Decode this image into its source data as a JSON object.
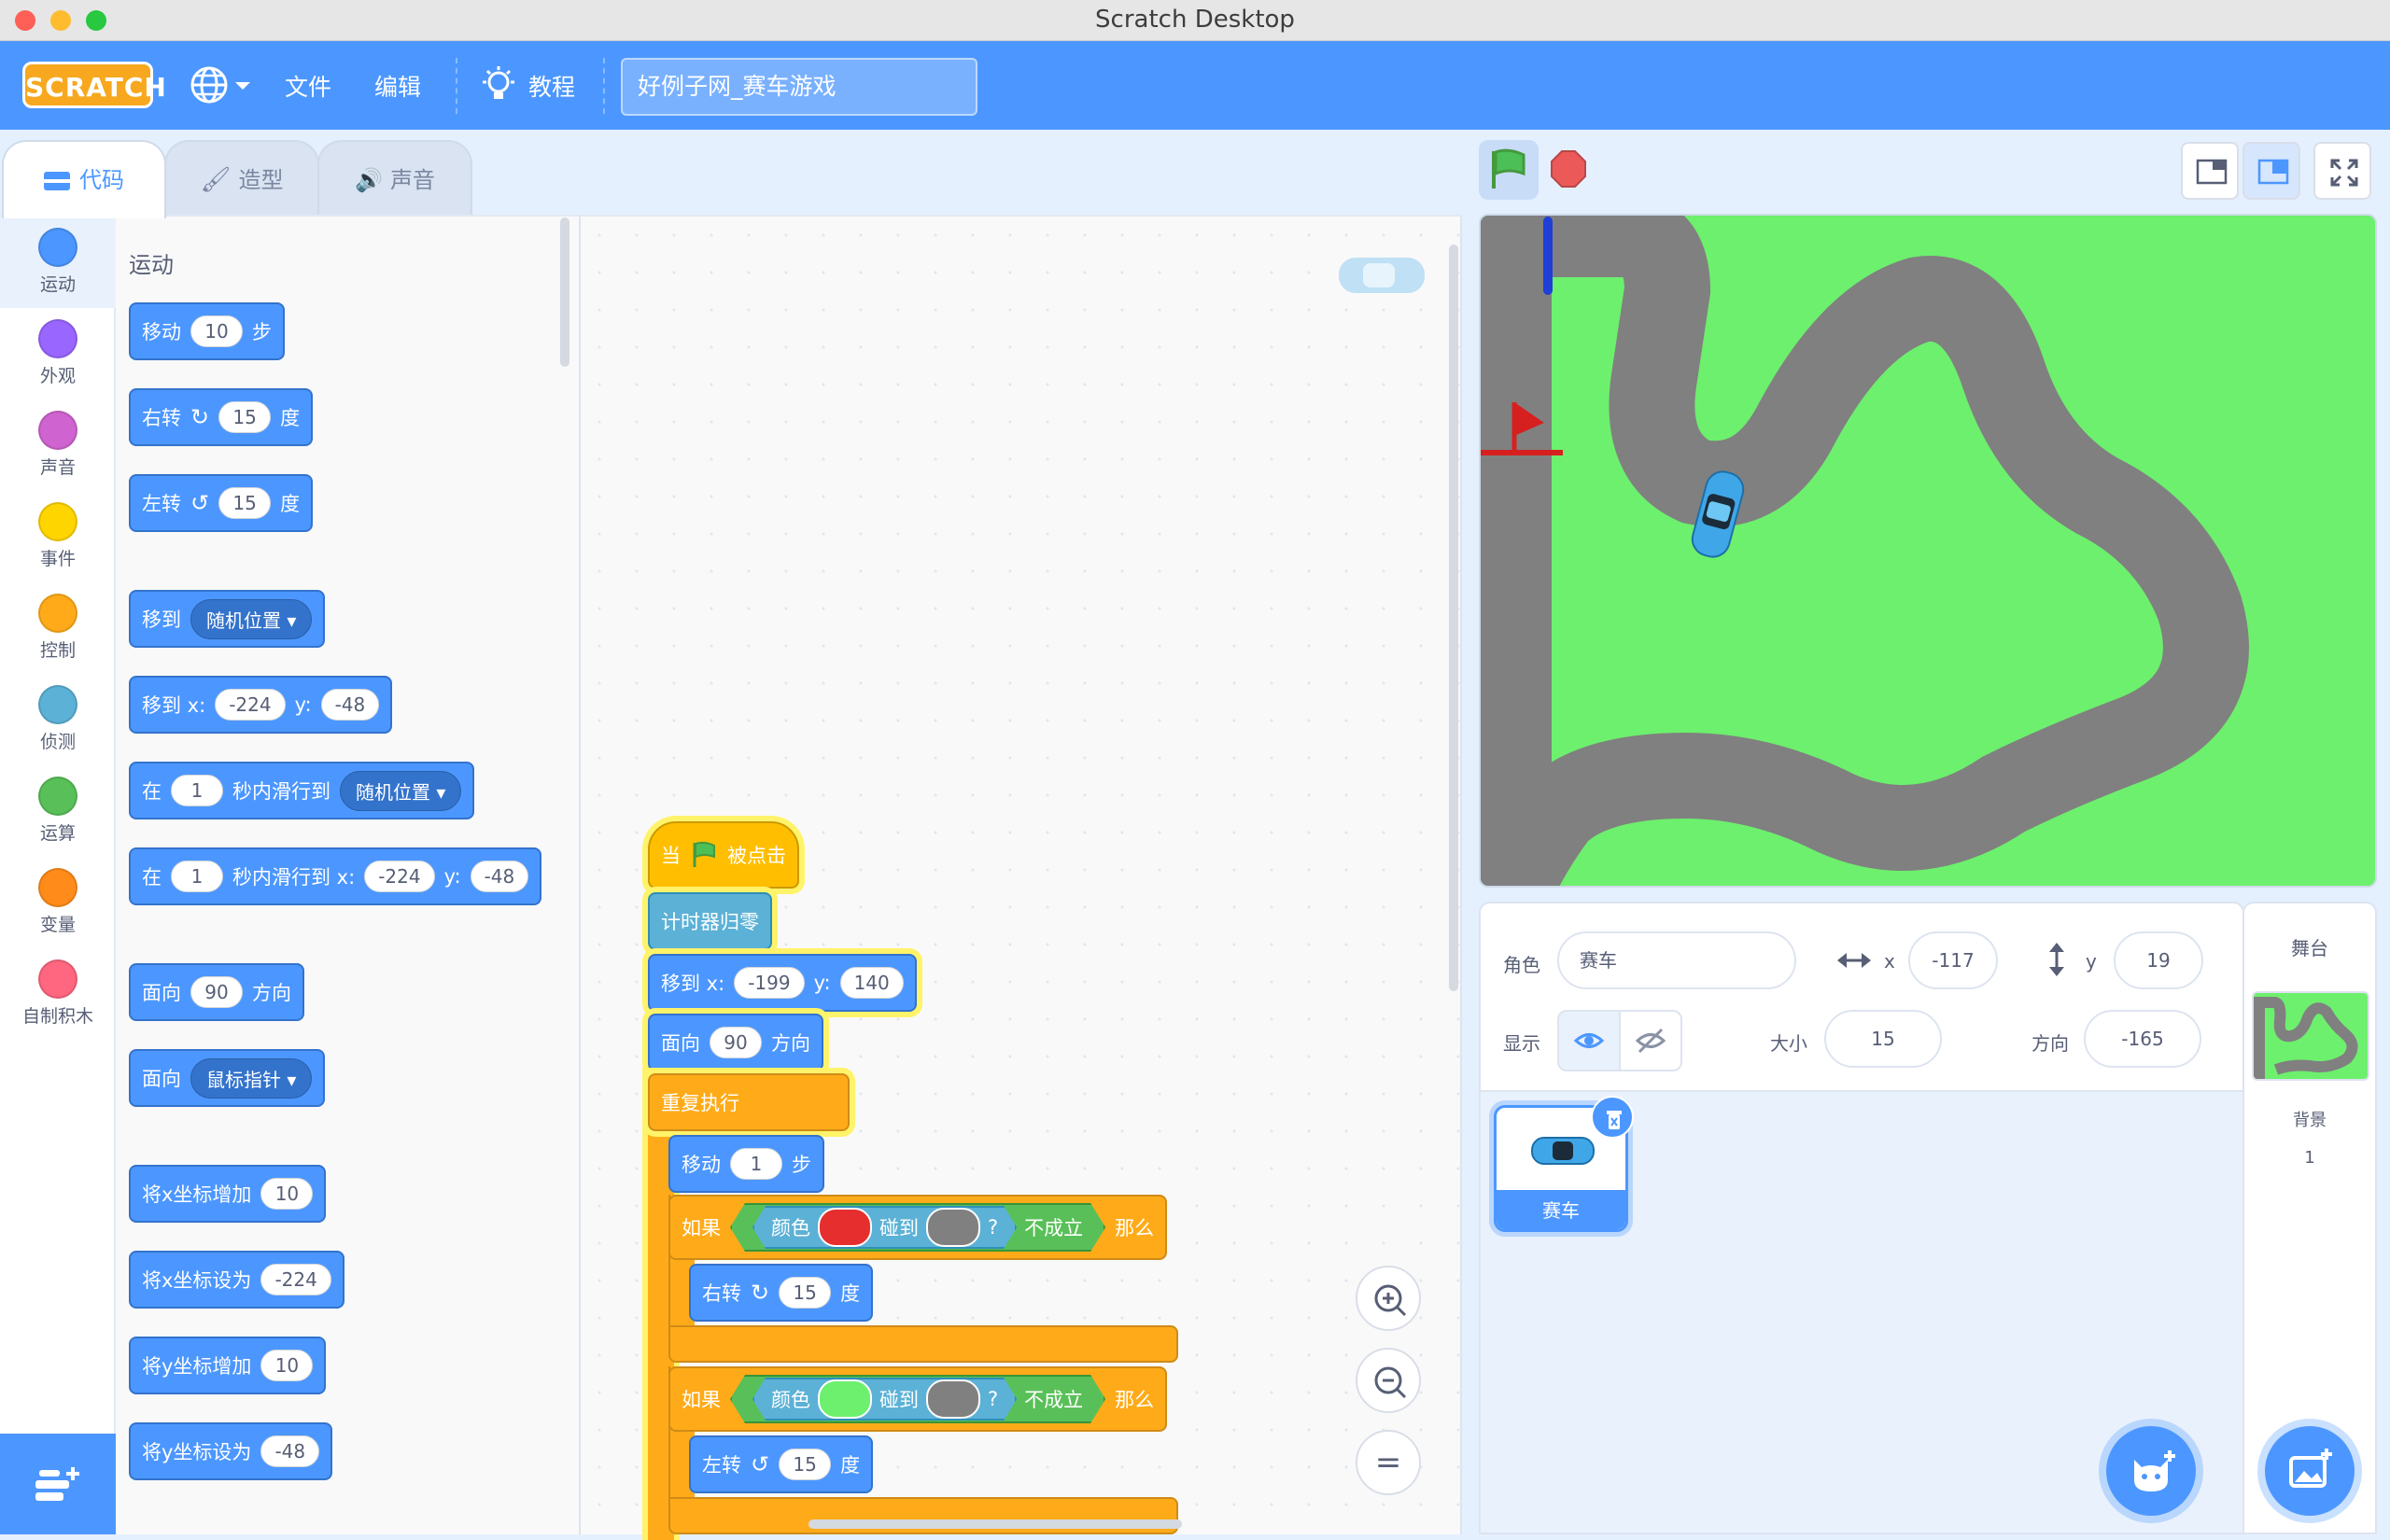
{
  "window": {
    "title": "Scratch Desktop"
  },
  "menubar": {
    "logo": "SCRATCH",
    "file": "文件",
    "edit": "编辑",
    "tutorials": "教程",
    "project_title": "好例子网_赛车游戏"
  },
  "tabs": {
    "code": "代码",
    "costumes": "造型",
    "sounds": "声音"
  },
  "categories": [
    {
      "label": "运动",
      "color": "#4c97ff"
    },
    {
      "label": "外观",
      "color": "#9966ff"
    },
    {
      "label": "声音",
      "color": "#cf63cf"
    },
    {
      "label": "事件",
      "color": "#ffd500"
    },
    {
      "label": "控制",
      "color": "#ffab19"
    },
    {
      "label": "侦测",
      "color": "#5cb1d6"
    },
    {
      "label": "运算",
      "color": "#59c059"
    },
    {
      "label": "变量",
      "color": "#ff8c1a"
    },
    {
      "label": "自制积木",
      "color": "#ff6680"
    }
  ],
  "palette": {
    "section_title": "运动",
    "move": {
      "label": "移动",
      "steps": "10",
      "unit": "步"
    },
    "turn_right": {
      "label": "右转",
      "deg": "15",
      "unit": "度"
    },
    "turn_left": {
      "label": "左转",
      "deg": "15",
      "unit": "度"
    },
    "goto": {
      "label": "移到",
      "target": "随机位置"
    },
    "goto_xy": {
      "label": "移到 x:",
      "x": "-224",
      "ylabel": "y:",
      "y": "-48"
    },
    "glide": {
      "pre": "在",
      "secs": "1",
      "mid": "秒内滑行到",
      "target": "随机位置"
    },
    "glide_xy": {
      "pre": "在",
      "secs": "1",
      "mid": "秒内滑行到 x:",
      "x": "-224",
      "ylabel": "y:",
      "y": "-48"
    },
    "point_dir": {
      "label": "面向",
      "dir": "90",
      "unit": "方向"
    },
    "point_towards": {
      "label": "面向",
      "target": "鼠标指针"
    },
    "change_x": {
      "label": "将x坐标增加",
      "val": "10"
    },
    "set_x": {
      "label": "将x坐标设为",
      "val": "-224"
    },
    "change_y": {
      "label": "将y坐标增加",
      "val": "10"
    },
    "set_y": {
      "label": "将y坐标设为",
      "val": "-48"
    }
  },
  "script": {
    "hat": {
      "pre": "当",
      "post": "被点击"
    },
    "reset_timer": "计时器归零",
    "goto_xy": {
      "label": "移到 x:",
      "x": "-199",
      "ylabel": "y:",
      "y": "140"
    },
    "point_dir": {
      "label": "面向",
      "dir": "90",
      "unit": "方向"
    },
    "forever": "重复执行",
    "move": {
      "label": "移动",
      "steps": "1",
      "unit": "步"
    },
    "if1": {
      "if": "如果",
      "color": "颜色",
      "touching": "碰到",
      "q": "?",
      "not": "不成立",
      "then": "那么",
      "c1": "#e62e2e",
      "c2": "#808080"
    },
    "turn_right": {
      "label": "右转",
      "deg": "15",
      "unit": "度"
    },
    "if2": {
      "if": "如果",
      "color": "颜色",
      "touching": "碰到",
      "q": "?",
      "not": "不成立",
      "then": "那么",
      "c1": "#6df06d",
      "c2": "#808080"
    },
    "turn_left": {
      "label": "左转",
      "deg": "15",
      "unit": "度"
    }
  },
  "zoom_controls": {
    "reset": "="
  },
  "sprite_info": {
    "sprite_label": "角色",
    "sprite_name": "赛车",
    "x_label": "x",
    "x": "-117",
    "y_label": "y",
    "y": "19",
    "show_label": "显示",
    "size_label": "大小",
    "size": "15",
    "direction_label": "方向",
    "direction": "-165"
  },
  "sprites": [
    {
      "name": "赛车"
    }
  ],
  "stage_panel": {
    "title": "舞台",
    "backdrop_label": "背景",
    "backdrop_count": "1"
  },
  "colors": {
    "accent": "#4c97ff",
    "grass": "#6df06d",
    "track": "#808080"
  }
}
